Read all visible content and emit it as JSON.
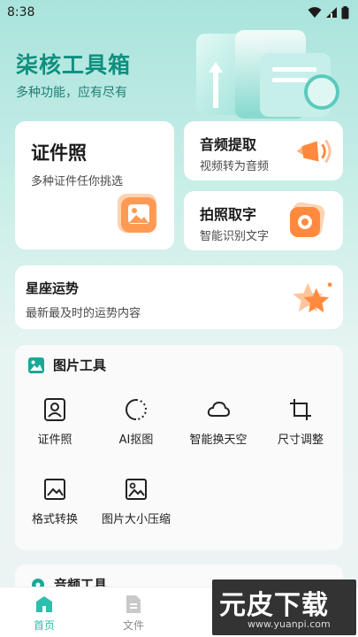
{
  "status": {
    "time": "8:38"
  },
  "app": {
    "title": "柒核工具箱",
    "subtitle": "多种功能，应有尽有"
  },
  "cards": {
    "id_photo": {
      "title": "证件照",
      "subtitle": "多种证件任你挑选"
    },
    "audio_extract": {
      "title": "音频提取",
      "subtitle": "视频转为音频"
    },
    "photo_text": {
      "title": "拍照取字",
      "subtitle": "智能识别文字"
    },
    "horoscope": {
      "title": "星座运势",
      "subtitle": "最新最及时的运势内容"
    }
  },
  "image_tools": {
    "title": "图片工具",
    "items": [
      {
        "label": "证件照",
        "icon": "portrait-icon"
      },
      {
        "label": "AI抠图",
        "icon": "cutout-icon"
      },
      {
        "label": "智能换天空",
        "icon": "cloud-icon"
      },
      {
        "label": "尺寸调整",
        "icon": "crop-icon"
      },
      {
        "label": "格式转换",
        "icon": "image-frame-icon"
      },
      {
        "label": "图片大小压缩",
        "icon": "compress-image-icon"
      }
    ]
  },
  "audio_tools": {
    "title": "音频工具"
  },
  "nav": {
    "home": {
      "label": "首页",
      "active_color": "#2bbfad"
    },
    "files": {
      "label": "文件"
    }
  },
  "watermark": {
    "text": "元皮下载",
    "url": "www.yuanpi.com"
  },
  "colors": {
    "accent": "#15a391",
    "orange": "#ff8a3d"
  }
}
